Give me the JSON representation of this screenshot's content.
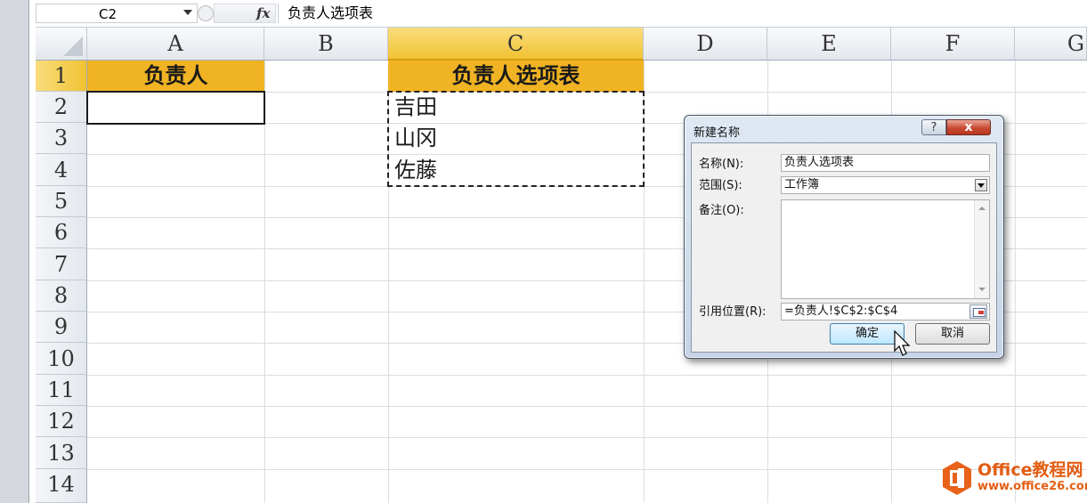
{
  "formula_bar": {
    "name_box": "C2",
    "fx_label": "fx",
    "content": "负责人选项表"
  },
  "columns": [
    "A",
    "B",
    "C",
    "D",
    "E",
    "F",
    "G"
  ],
  "rows": [
    "1",
    "2",
    "3",
    "4",
    "5",
    "6",
    "7",
    "8",
    "9",
    "10",
    "11",
    "12",
    "13",
    "14"
  ],
  "cells": {
    "A1": "负责人",
    "C1": "负责人选项表",
    "C2": "吉田",
    "C3": "山冈",
    "C4": "佐藤"
  },
  "dialog": {
    "title": "新建名称",
    "help_label": "?",
    "close_label": "x",
    "name_label": "名称(N):",
    "name_value": "负责人选项表",
    "scope_label": "范围(S):",
    "scope_value": "工作簿",
    "comment_label": "备注(O):",
    "comment_value": "",
    "refers_label": "引用位置(R):",
    "refers_value": "=负责人!$C$2:$C$4",
    "ok_label": "确定",
    "cancel_label": "取消"
  },
  "watermark": {
    "title": "Office教程网",
    "url": "www.office26.com"
  },
  "colors": {
    "header_fill": "#f0b323",
    "selected_header": "#f1c232",
    "logo_orange": "#e35d12"
  }
}
